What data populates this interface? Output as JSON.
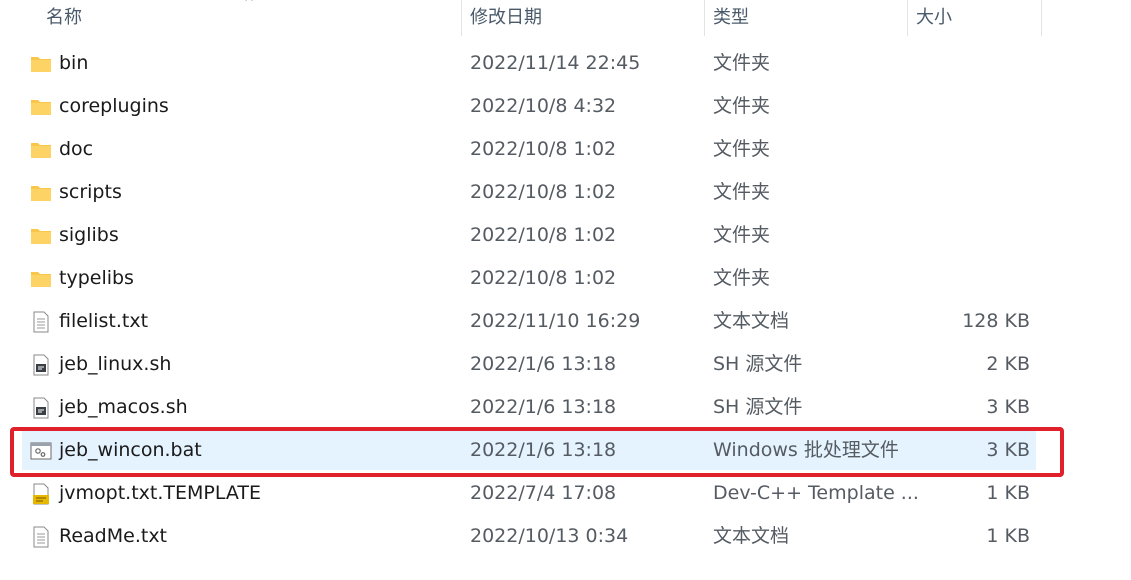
{
  "columns": {
    "name": "名称",
    "date": "修改日期",
    "type": "类型",
    "size": "大小"
  },
  "files": [
    {
      "name": "bin",
      "date": "2022/11/14 22:45",
      "type": "文件夹",
      "size": "",
      "icon": "folder-icon"
    },
    {
      "name": "coreplugins",
      "date": "2022/10/8 4:32",
      "type": "文件夹",
      "size": "",
      "icon": "folder-icon"
    },
    {
      "name": "doc",
      "date": "2022/10/8 1:02",
      "type": "文件夹",
      "size": "",
      "icon": "folder-icon"
    },
    {
      "name": "scripts",
      "date": "2022/10/8 1:02",
      "type": "文件夹",
      "size": "",
      "icon": "folder-icon"
    },
    {
      "name": "siglibs",
      "date": "2022/10/8 1:02",
      "type": "文件夹",
      "size": "",
      "icon": "folder-icon"
    },
    {
      "name": "typelibs",
      "date": "2022/10/8 1:02",
      "type": "文件夹",
      "size": "",
      "icon": "folder-icon"
    },
    {
      "name": "filelist.txt",
      "date": "2022/11/10 16:29",
      "type": "文本文档",
      "size": "128 KB",
      "icon": "text-file-icon"
    },
    {
      "name": "jeb_linux.sh",
      "date": "2022/1/6 13:18",
      "type": "SH 源文件",
      "size": "2 KB",
      "icon": "script-file-icon"
    },
    {
      "name": "jeb_macos.sh",
      "date": "2022/1/6 13:18",
      "type": "SH 源文件",
      "size": "3 KB",
      "icon": "script-file-icon"
    },
    {
      "name": "jeb_wincon.bat",
      "date": "2022/1/6 13:18",
      "type": "Windows 批处理文件",
      "size": "3 KB",
      "icon": "batch-file-icon",
      "selected": true
    },
    {
      "name": "jvmopt.txt.TEMPLATE",
      "date": "2022/7/4 17:08",
      "type": "Dev-C++ Template ...",
      "size": "1 KB",
      "icon": "template-file-icon"
    },
    {
      "name": "ReadMe.txt",
      "date": "2022/10/13 0:34",
      "type": "文本文档",
      "size": "1 KB",
      "icon": "text-file-icon"
    }
  ],
  "colors": {
    "selected_row": "#e5f3ff",
    "highlight_border": "#e0202a",
    "folder": "#f8c74a"
  }
}
